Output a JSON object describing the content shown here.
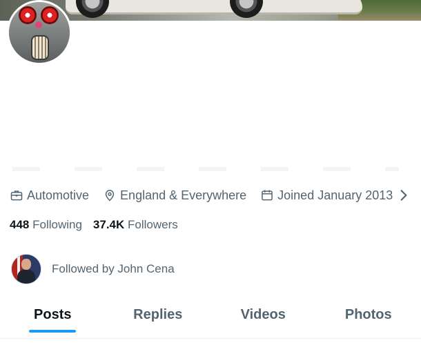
{
  "profile": {
    "meta": {
      "category": "Automotive",
      "location": "England & Everywhere",
      "joined": "Joined January 2013"
    },
    "following_count": "448",
    "following_label": "Following",
    "followers_count": "37.4K",
    "followers_label": "Followers",
    "followed_by": "Followed by John Cena"
  },
  "tabs": [
    {
      "label": "Posts",
      "active": true
    },
    {
      "label": "Replies",
      "active": false
    },
    {
      "label": "Videos",
      "active": false
    },
    {
      "label": "Photos",
      "active": false
    }
  ],
  "icons": {
    "category": "briefcase-icon",
    "location": "location-pin-icon",
    "joined": "calendar-icon",
    "more": "chevron-right-icon"
  },
  "colors": {
    "accent": "#1d9bf0",
    "text_primary": "#0f1419",
    "text_secondary": "#536471"
  }
}
